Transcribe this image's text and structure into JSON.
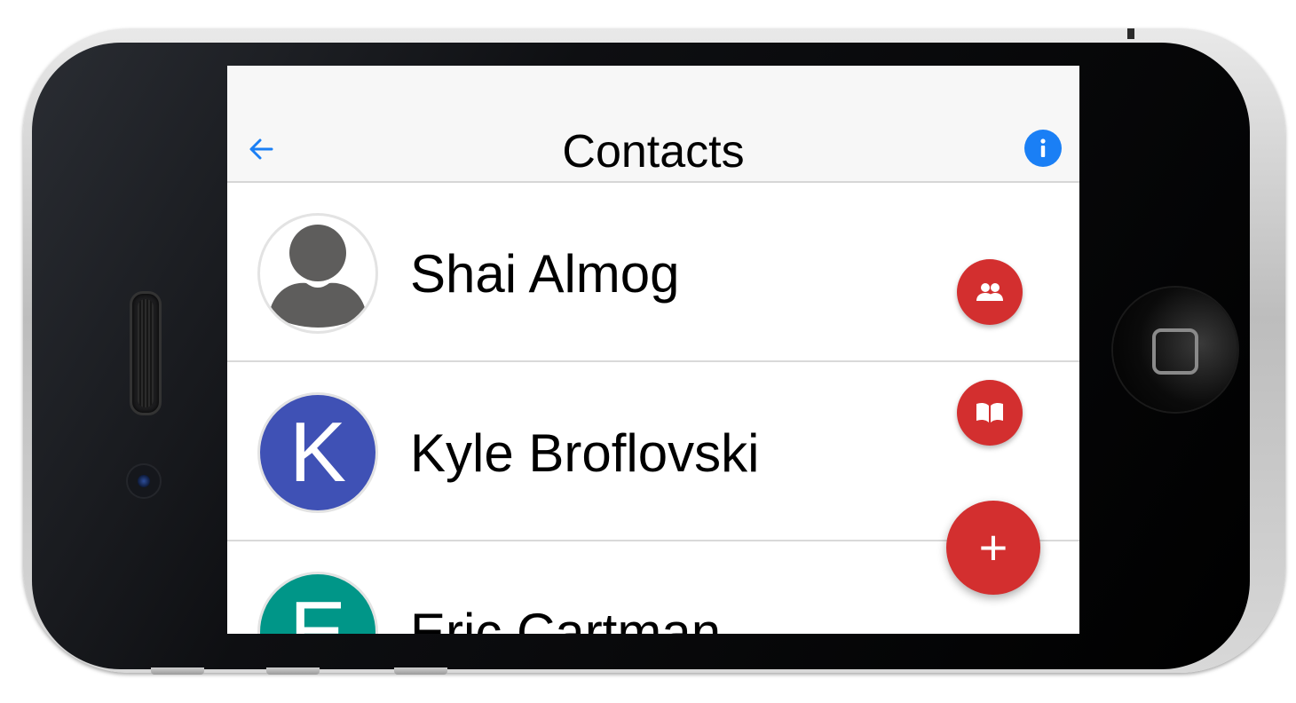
{
  "header": {
    "title": "Contacts",
    "back_icon": "arrow-left-icon",
    "info_icon": "info-icon"
  },
  "contacts": [
    {
      "name": "Shai Almog",
      "avatar_type": "placeholder-person-icon"
    },
    {
      "name": "Kyle Broflovski",
      "avatar_letter": "K",
      "avatar_color": "#3f51b5"
    },
    {
      "name": "Eric Cartman",
      "avatar_letter": "E",
      "avatar_color": "#009688"
    }
  ],
  "fab": {
    "group_icon": "people-icon",
    "contacts_book_icon": "book-icon",
    "add_label": "+"
  },
  "colors": {
    "accent": "#1a7ff5",
    "fab": "#d32f2f"
  }
}
